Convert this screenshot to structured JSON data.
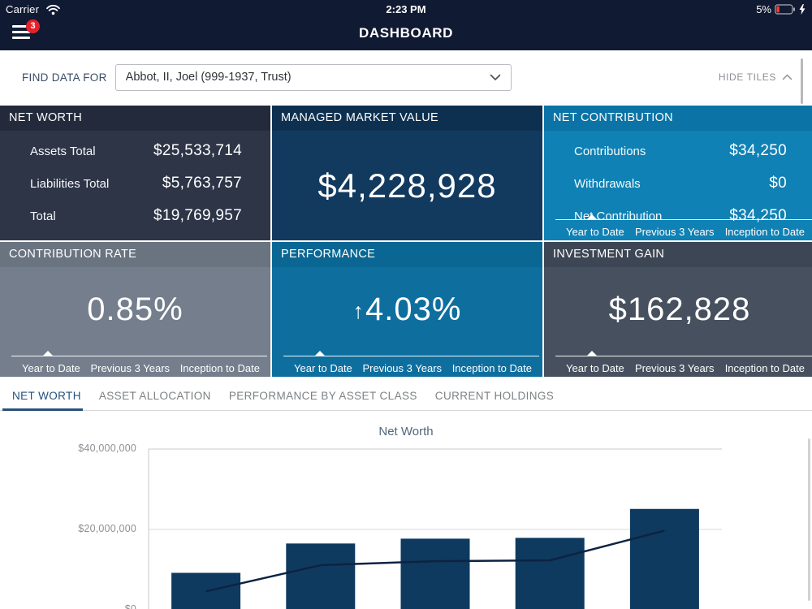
{
  "status_bar": {
    "carrier": "Carrier",
    "time": "2:23 PM",
    "battery_percent": "5%"
  },
  "header": {
    "title": "DASHBOARD",
    "menu_badge": "3"
  },
  "find_bar": {
    "label": "FIND DATA FOR",
    "selected_value": "Abbot, II, Joel (999-1937, Trust)",
    "hide_tiles_label": "HIDE TILES"
  },
  "period_tabs": [
    "Year to Date",
    "Previous 3 Years",
    "Inception to Date"
  ],
  "tiles": {
    "net_worth": {
      "title": "NET WORTH",
      "rows": [
        {
          "label": "Assets Total",
          "value": "$25,533,714"
        },
        {
          "label": "Liabilities Total",
          "value": "$5,763,757"
        },
        {
          "label": "Total",
          "value": "$19,769,957"
        }
      ]
    },
    "managed_market_value": {
      "title": "MANAGED MARKET VALUE",
      "value": "$4,228,928"
    },
    "net_contribution": {
      "title": "NET CONTRIBUTION",
      "rows": [
        {
          "label": "Contributions",
          "value": "$34,250"
        },
        {
          "label": "Withdrawals",
          "value": "$0"
        },
        {
          "label": "Net Contribution",
          "value": "$34,250"
        }
      ],
      "selected_period": "Year to Date"
    },
    "contribution_rate": {
      "title": "CONTRIBUTION RATE",
      "value": "0.85%",
      "selected_period": "Year to Date"
    },
    "performance": {
      "title": "PERFORMANCE",
      "value": "4.03%",
      "direction": "up",
      "up_arrow": "↑",
      "selected_period": "Year to Date"
    },
    "investment_gain": {
      "title": "INVESTMENT GAIN",
      "value": "$162,828",
      "selected_period": "Year to Date"
    }
  },
  "section_tabs": [
    {
      "label": "NET WORTH",
      "active": true
    },
    {
      "label": "ASSET ALLOCATION",
      "active": false
    },
    {
      "label": "PERFORMANCE BY ASSET CLASS",
      "active": false
    },
    {
      "label": "CURRENT HOLDINGS",
      "active": false
    }
  ],
  "chart_data": {
    "type": "bar",
    "title": "Net Worth",
    "series": [
      {
        "name": "bars",
        "type": "bar",
        "values": [
          9200000,
          16500000,
          17700000,
          17900000,
          25100000
        ]
      },
      {
        "name": "line",
        "type": "line",
        "values": [
          4600000,
          11100000,
          12100000,
          12300000,
          19700000
        ]
      }
    ],
    "ylim": [
      0,
      40000000
    ],
    "yticks": [
      {
        "label": "$0",
        "value": 0
      },
      {
        "label": "$20,000,000",
        "value": 20000000
      },
      {
        "label": "$40,000,000",
        "value": 40000000
      }
    ],
    "grid": true,
    "legend": "none",
    "bar_color": "#0e3a5f",
    "line_color": "#0d2342",
    "x_axis_labels_visible": false
  },
  "colors": {
    "header_bg": "#111a33",
    "badge_red": "#e62129",
    "teal_tile": "#0f81b4",
    "navy_tile": "#123a5f",
    "slate_tile": "#2d3547",
    "gray_tile": "#757e8c",
    "dark_slate_tile": "#47505e",
    "active_tab": "#24507c",
    "bar_color": "#0e3a5f",
    "line_color": "#0d2342"
  }
}
